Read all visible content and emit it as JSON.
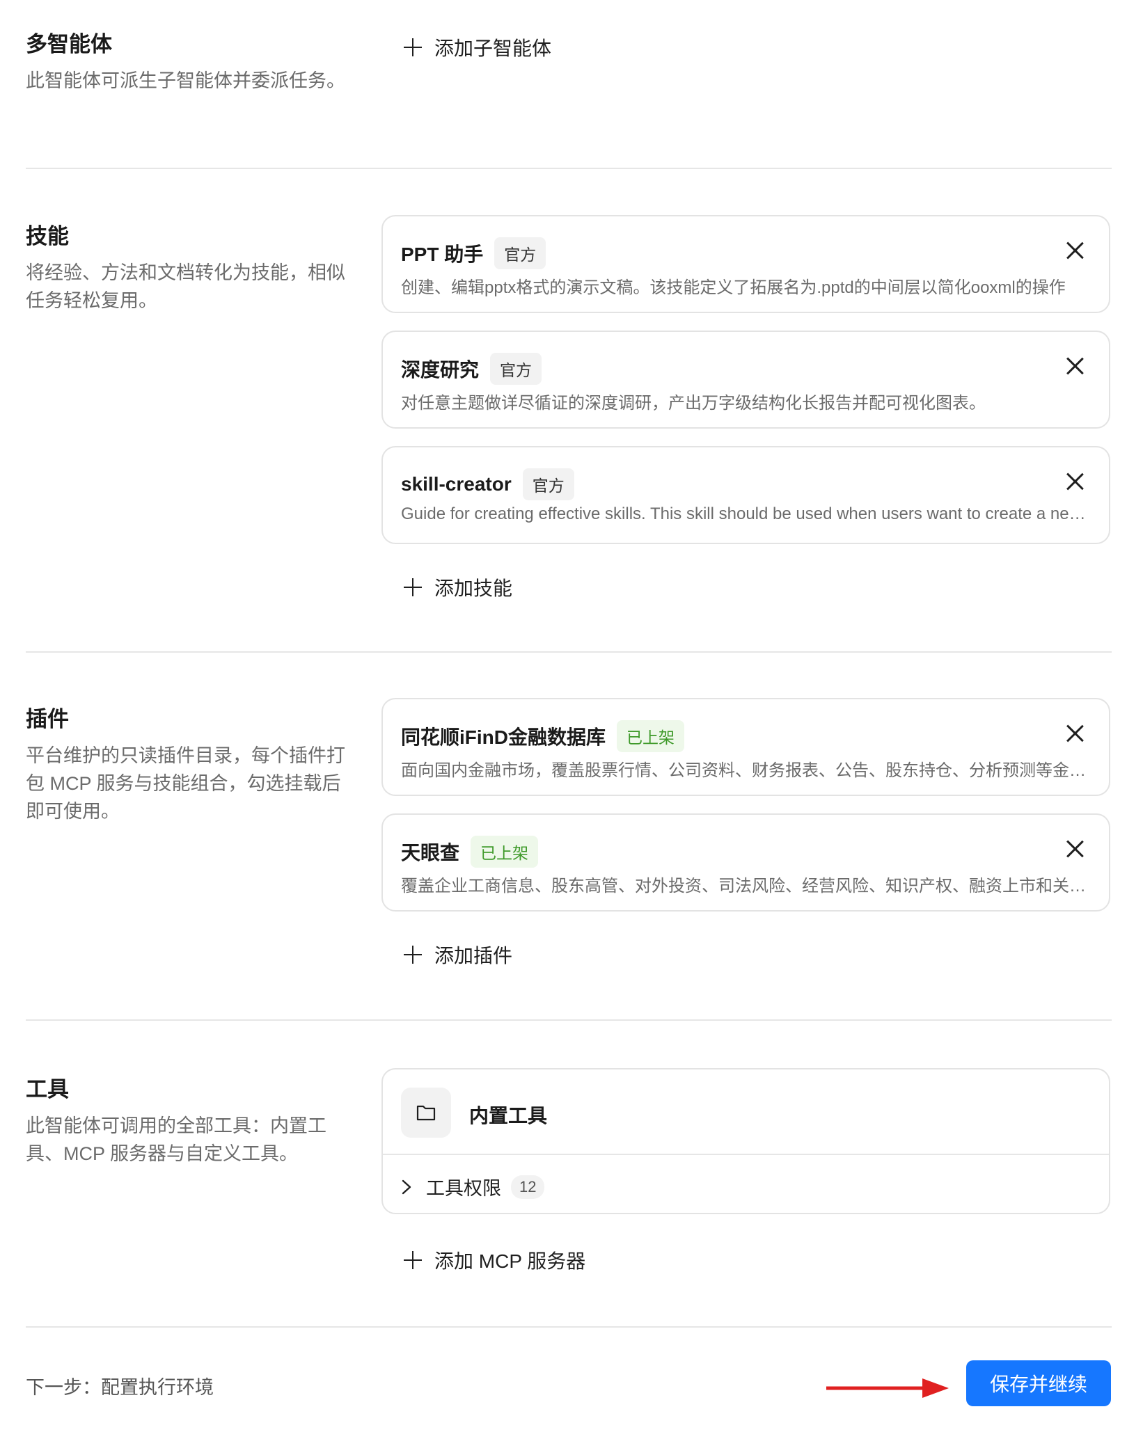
{
  "subagents": {
    "title": "多智能体",
    "desc": "此智能体可派生子智能体并委派任务。",
    "add_label": "添加子智能体"
  },
  "skills": {
    "title": "技能",
    "desc": "将经验、方法和文档转化为技能，相似任务轻松复用。",
    "items": [
      {
        "name": "PPT 助手",
        "badge": "官方",
        "desc": "创建、编辑pptx格式的演示文稿。该技能定义了拓展名为.pptd的中间层以简化ooxml的操作"
      },
      {
        "name": "深度研究",
        "badge": "官方",
        "desc": "对任意主题做详尽循证的深度调研，产出万字级结构化长报告并配可视化图表。"
      },
      {
        "name": "skill-creator",
        "badge": "官方",
        "desc": "Guide for creating effective skills. This skill should be used when users want to create a new skill"
      }
    ],
    "add_label": "添加技能"
  },
  "plugins": {
    "title": "插件",
    "desc": "平台维护的只读插件目录，每个插件打包 MCP 服务与技能组合，勾选挂载后即可使用。",
    "items": [
      {
        "name": "同花顺iFinD金融数据库",
        "badge": "已上架",
        "desc": "面向国内金融市场，覆盖股票行情、公司资料、财务报表、公告、股东持仓、分析预测等金融数据"
      },
      {
        "name": "天眼查",
        "badge": "已上架",
        "desc": "覆盖企业工商信息、股东高管、对外投资、司法风险、经营风险、知识产权、融资上市和关联关系"
      }
    ],
    "add_label": "添加插件"
  },
  "tools": {
    "title": "工具",
    "desc": "此智能体可调用的全部工具：内置工具、MCP 服务器与自定义工具。",
    "builtin_title": "内置工具",
    "permissions_label": "工具权限",
    "permissions_count": "12",
    "add_label": "添加 MCP 服务器"
  },
  "footer": {
    "next_step": "下一步：配置执行环境",
    "save_label": "保存并继续"
  },
  "colors": {
    "primary": "#1677ff",
    "badge_green_text": "#3f9a2a",
    "arrow": "#e02020"
  }
}
